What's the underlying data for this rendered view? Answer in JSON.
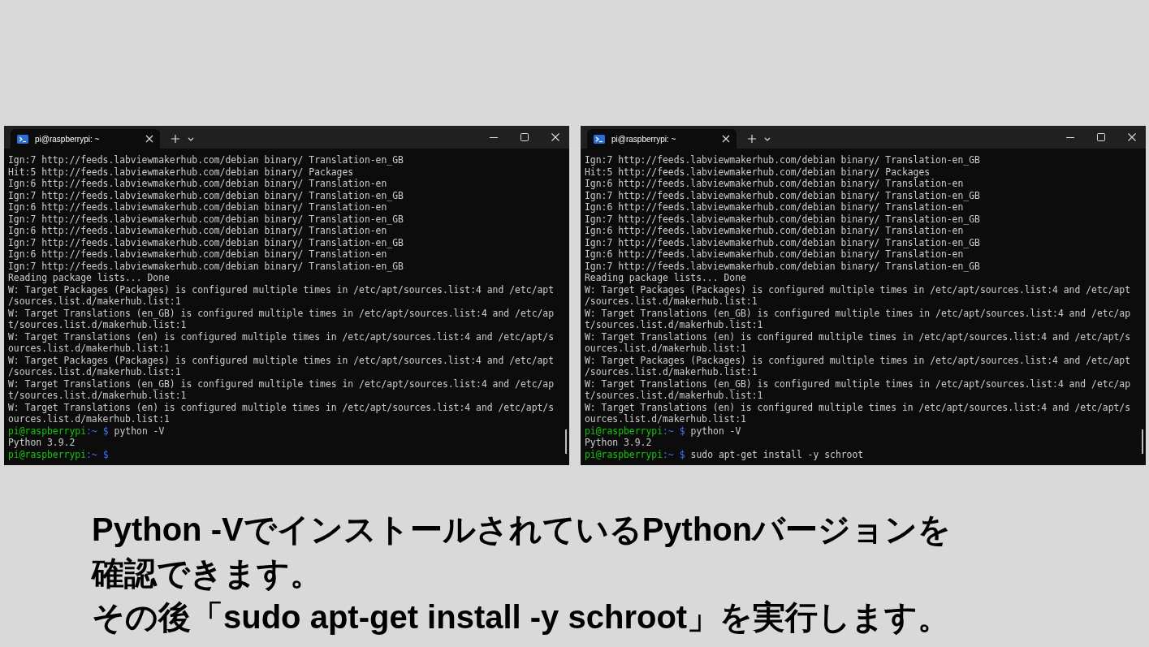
{
  "terminals": [
    {
      "tab_title": "pi@raspberrypi: ~",
      "lines": [
        {
          "kind": "text",
          "text": "Ign:7 http://feeds.labviewmakerhub.com/debian binary/ Translation-en_GB"
        },
        {
          "kind": "text",
          "text": "Hit:5 http://feeds.labviewmakerhub.com/debian binary/ Packages"
        },
        {
          "kind": "text",
          "text": "Ign:6 http://feeds.labviewmakerhub.com/debian binary/ Translation-en"
        },
        {
          "kind": "text",
          "text": "Ign:7 http://feeds.labviewmakerhub.com/debian binary/ Translation-en_GB"
        },
        {
          "kind": "text",
          "text": "Ign:6 http://feeds.labviewmakerhub.com/debian binary/ Translation-en"
        },
        {
          "kind": "text",
          "text": "Ign:7 http://feeds.labviewmakerhub.com/debian binary/ Translation-en_GB"
        },
        {
          "kind": "text",
          "text": "Ign:6 http://feeds.labviewmakerhub.com/debian binary/ Translation-en"
        },
        {
          "kind": "text",
          "text": "Ign:7 http://feeds.labviewmakerhub.com/debian binary/ Translation-en_GB"
        },
        {
          "kind": "text",
          "text": "Ign:6 http://feeds.labviewmakerhub.com/debian binary/ Translation-en"
        },
        {
          "kind": "text",
          "text": "Ign:7 http://feeds.labviewmakerhub.com/debian binary/ Translation-en_GB"
        },
        {
          "kind": "text",
          "text": "Reading package lists... Done"
        },
        {
          "kind": "text",
          "text": "W: Target Packages (Packages) is configured multiple times in /etc/apt/sources.list:4 and /etc/apt"
        },
        {
          "kind": "text",
          "text": "/sources.list.d/makerhub.list:1"
        },
        {
          "kind": "text",
          "text": "W: Target Translations (en_GB) is configured multiple times in /etc/apt/sources.list:4 and /etc/ap"
        },
        {
          "kind": "text",
          "text": "t/sources.list.d/makerhub.list:1"
        },
        {
          "kind": "text",
          "text": "W: Target Translations (en) is configured multiple times in /etc/apt/sources.list:4 and /etc/apt/s"
        },
        {
          "kind": "text",
          "text": "ources.list.d/makerhub.list:1"
        },
        {
          "kind": "text",
          "text": "W: Target Packages (Packages) is configured multiple times in /etc/apt/sources.list:4 and /etc/apt"
        },
        {
          "kind": "text",
          "text": "/sources.list.d/makerhub.list:1"
        },
        {
          "kind": "text",
          "text": "W: Target Translations (en_GB) is configured multiple times in /etc/apt/sources.list:4 and /etc/ap"
        },
        {
          "kind": "text",
          "text": "t/sources.list.d/makerhub.list:1"
        },
        {
          "kind": "text",
          "text": "W: Target Translations (en) is configured multiple times in /etc/apt/sources.list:4 and /etc/apt/s"
        },
        {
          "kind": "text",
          "text": "ources.list.d/makerhub.list:1"
        },
        {
          "kind": "prompt",
          "host": "pi@raspberrypi",
          "path": ":~",
          "symbol": "$",
          "command": "python -V"
        },
        {
          "kind": "text",
          "text": "Python 3.9.2"
        },
        {
          "kind": "prompt",
          "host": "pi@raspberrypi",
          "path": ":~",
          "symbol": "$"
        }
      ]
    },
    {
      "tab_title": "pi@raspberrypi: ~",
      "lines": [
        {
          "kind": "text",
          "text": "Ign:7 http://feeds.labviewmakerhub.com/debian binary/ Translation-en_GB"
        },
        {
          "kind": "text",
          "text": "Hit:5 http://feeds.labviewmakerhub.com/debian binary/ Packages"
        },
        {
          "kind": "text",
          "text": "Ign:6 http://feeds.labviewmakerhub.com/debian binary/ Translation-en"
        },
        {
          "kind": "text",
          "text": "Ign:7 http://feeds.labviewmakerhub.com/debian binary/ Translation-en_GB"
        },
        {
          "kind": "text",
          "text": "Ign:6 http://feeds.labviewmakerhub.com/debian binary/ Translation-en"
        },
        {
          "kind": "text",
          "text": "Ign:7 http://feeds.labviewmakerhub.com/debian binary/ Translation-en_GB"
        },
        {
          "kind": "text",
          "text": "Ign:6 http://feeds.labviewmakerhub.com/debian binary/ Translation-en"
        },
        {
          "kind": "text",
          "text": "Ign:7 http://feeds.labviewmakerhub.com/debian binary/ Translation-en_GB"
        },
        {
          "kind": "text",
          "text": "Ign:6 http://feeds.labviewmakerhub.com/debian binary/ Translation-en"
        },
        {
          "kind": "text",
          "text": "Ign:7 http://feeds.labviewmakerhub.com/debian binary/ Translation-en_GB"
        },
        {
          "kind": "text",
          "text": "Reading package lists... Done"
        },
        {
          "kind": "text",
          "text": "W: Target Packages (Packages) is configured multiple times in /etc/apt/sources.list:4 and /etc/apt"
        },
        {
          "kind": "text",
          "text": "/sources.list.d/makerhub.list:1"
        },
        {
          "kind": "text",
          "text": "W: Target Translations (en_GB) is configured multiple times in /etc/apt/sources.list:4 and /etc/ap"
        },
        {
          "kind": "text",
          "text": "t/sources.list.d/makerhub.list:1"
        },
        {
          "kind": "text",
          "text": "W: Target Translations (en) is configured multiple times in /etc/apt/sources.list:4 and /etc/apt/s"
        },
        {
          "kind": "text",
          "text": "ources.list.d/makerhub.list:1"
        },
        {
          "kind": "text",
          "text": "W: Target Packages (Packages) is configured multiple times in /etc/apt/sources.list:4 and /etc/apt"
        },
        {
          "kind": "text",
          "text": "/sources.list.d/makerhub.list:1"
        },
        {
          "kind": "text",
          "text": "W: Target Translations (en_GB) is configured multiple times in /etc/apt/sources.list:4 and /etc/ap"
        },
        {
          "kind": "text",
          "text": "t/sources.list.d/makerhub.list:1"
        },
        {
          "kind": "text",
          "text": "W: Target Translations (en) is configured multiple times in /etc/apt/sources.list:4 and /etc/apt/s"
        },
        {
          "kind": "text",
          "text": "ources.list.d/makerhub.list:1"
        },
        {
          "kind": "prompt",
          "host": "pi@raspberrypi",
          "path": ":~",
          "symbol": "$",
          "command": "python -V"
        },
        {
          "kind": "text",
          "text": "Python 3.9.2"
        },
        {
          "kind": "prompt",
          "host": "pi@raspberrypi",
          "path": ":~",
          "symbol": "$",
          "command": "sudo apt-get install -y schroot"
        }
      ]
    }
  ],
  "caption": [
    "Python -VでインストールされているPythonバージョンを",
    "確認できます。",
    "その後「sudo apt-get install -y schroot」を実行します。"
  ]
}
